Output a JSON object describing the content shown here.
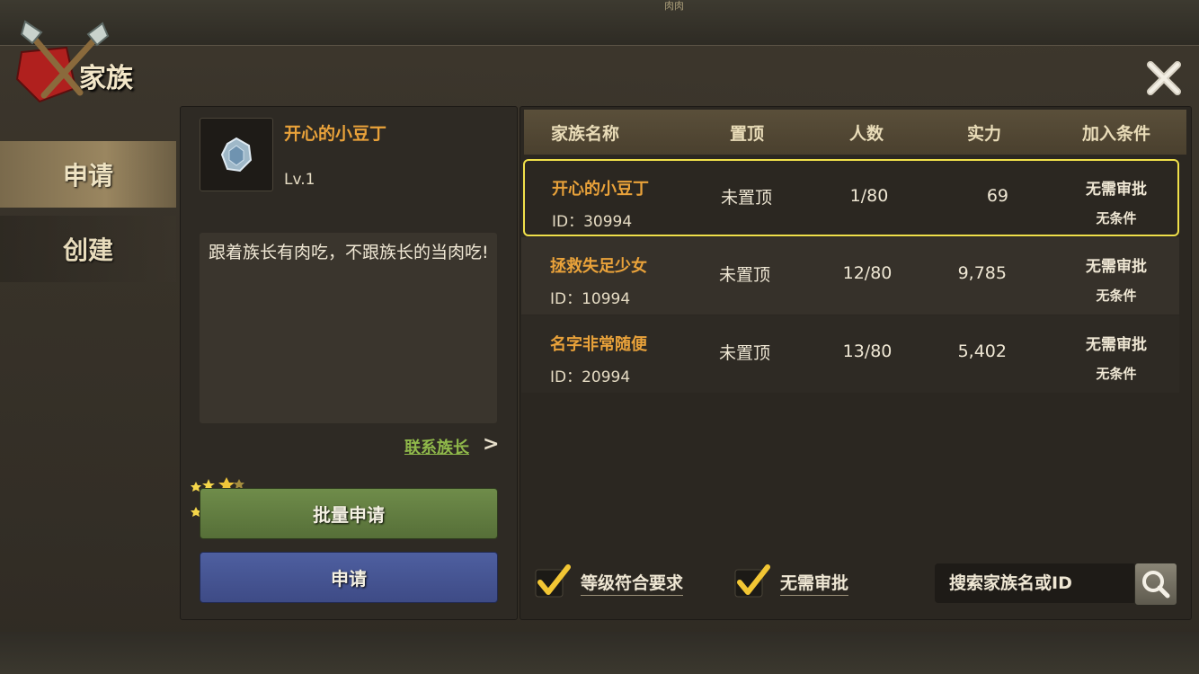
{
  "header": {
    "title": "家族",
    "top_mini_text": "肉肉"
  },
  "tabs": [
    {
      "label": "申请",
      "active": true
    },
    {
      "label": "创建",
      "active": false
    }
  ],
  "selected_clan": {
    "name": "开心的小豆丁",
    "level": "Lv.1",
    "description": "跟着族长有肉吃，不跟族长的当肉吃!",
    "contact_label": "联系族长",
    "contact_arrow": ">"
  },
  "buttons": {
    "batch_apply": "批量申请",
    "apply": "申请"
  },
  "table": {
    "columns": [
      "家族名称",
      "置顶",
      "人数",
      "实力",
      "加入条件"
    ],
    "rows": [
      {
        "name": "开心的小豆丁",
        "id": "ID：30994",
        "pin": "未置顶",
        "members": "1/80",
        "power": "69",
        "cond1": "无需审批",
        "cond2": "无条件",
        "selected": true
      },
      {
        "name": "拯救失足少女",
        "id": "ID：10994",
        "pin": "未置顶",
        "members": "12/80",
        "power": "9,785",
        "cond1": "无需审批",
        "cond2": "无条件",
        "selected": false
      },
      {
        "name": "名字非常随便",
        "id": "ID：20994",
        "pin": "未置顶",
        "members": "13/80",
        "power": "5,402",
        "cond1": "无需审批",
        "cond2": "无条件",
        "selected": false
      }
    ]
  },
  "filters": {
    "level_match": {
      "label": "等级符合要求",
      "checked": true
    },
    "no_approval": {
      "label": "无需审批",
      "checked": true
    }
  },
  "search": {
    "placeholder": "搜索家族名或ID"
  },
  "colors": {
    "accent_orange": "#e9a23a",
    "selected_border": "#f0e04a",
    "contact_green": "#8fb84a",
    "batch_button": "#6f8c4a",
    "apply_button": "#4e5fa0"
  },
  "icons": {
    "logo": "crossed-spears-emblem-icon",
    "close": "close-icon",
    "avatar": "clan-crystal-icon",
    "check": "checkmark-icon",
    "search": "search-icon",
    "stars": "stars-sparkle-icon"
  }
}
